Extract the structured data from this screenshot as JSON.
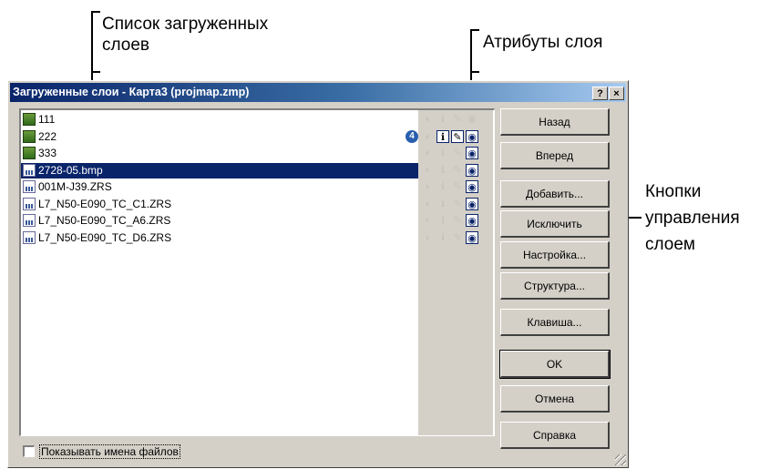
{
  "callouts": {
    "list": "Список загруженных\nслоев",
    "attributes": "Атрибуты слоя",
    "buttons": "Кнопки\nуправления\nслоем"
  },
  "dialog": {
    "title": "Загруженные слои - Карта3 (projmap.zmp)",
    "help_btn": "?",
    "close_btn": "×"
  },
  "layers": [
    {
      "name": "111",
      "icon": "vector-layer-icon",
      "selected": false
    },
    {
      "name": "222",
      "icon": "vector-layer-icon",
      "selected": false,
      "badge": "4"
    },
    {
      "name": "333",
      "icon": "vector-layer-icon",
      "selected": false
    },
    {
      "name": "2728-05.bmp",
      "icon": "raster-layer-icon",
      "selected": true
    },
    {
      "name": "001M-J39.ZRS",
      "icon": "raster-layer-icon",
      "selected": false
    },
    {
      "name": "L7_N50-E090_TC_C1.ZRS",
      "icon": "raster-layer-icon",
      "selected": false
    },
    {
      "name": "L7_N50-E090_TC_A6.ZRS",
      "icon": "raster-layer-icon",
      "selected": false
    },
    {
      "name": "L7_N50-E090_TC_D6.ZRS",
      "icon": "raster-layer-icon",
      "selected": false
    }
  ],
  "buttons": {
    "back": "Назад",
    "forward": "Вперед",
    "add": "Добавить...",
    "remove": "Исключить",
    "settings": "Настройка...",
    "structure": "Структура...",
    "hotkey": "Клавиша...",
    "ok": "OK",
    "cancel": "Отмена",
    "help": "Справка"
  },
  "show_filenames": {
    "label": "Показывать имена файлов",
    "checked": false
  }
}
